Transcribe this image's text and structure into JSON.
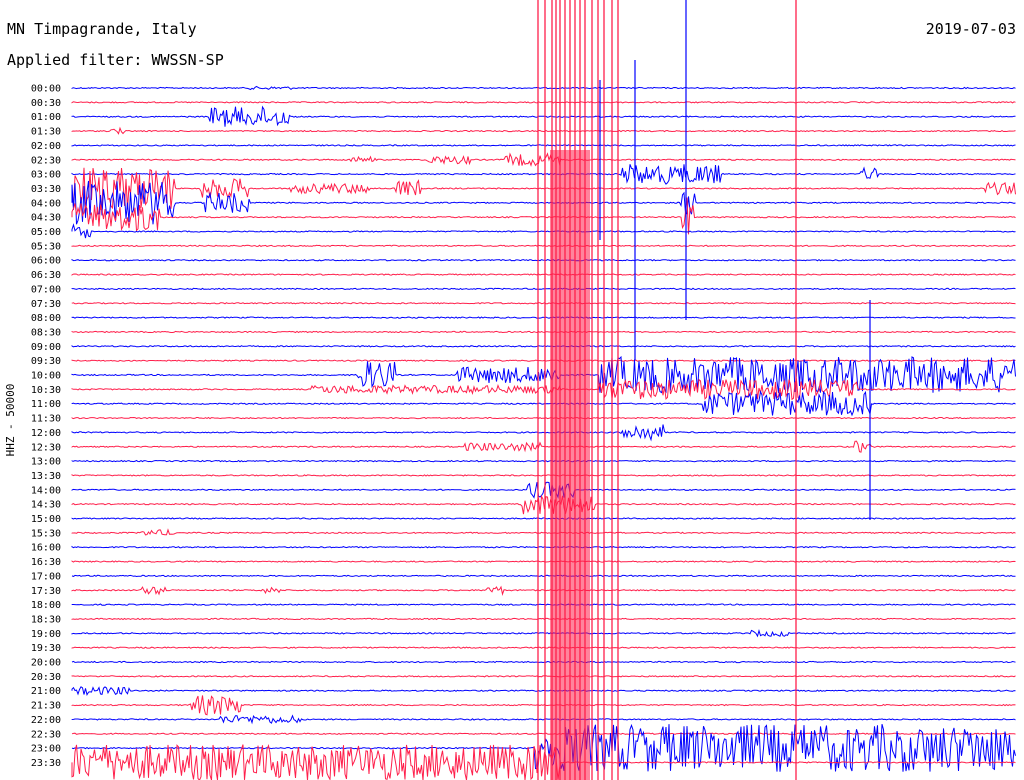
{
  "header": {
    "station": "MN Timpagrande, Italy",
    "filter": "Applied filter: WWSSN-SP",
    "date": "2019-07-03"
  },
  "side_label": "HHZ - 50000",
  "colors": {
    "blue": "#0000ff",
    "red": "#ff1f4b",
    "text": "#000000"
  },
  "chart_data": {
    "type": "line",
    "title": "MN Timpagrande, Italy",
    "ylabel": "HHZ - 50000",
    "grid": false,
    "row_labels": [
      "00:00",
      "00:30",
      "01:00",
      "01:30",
      "02:00",
      "02:30",
      "03:00",
      "03:30",
      "04:00",
      "04:30",
      "05:00",
      "05:30",
      "06:00",
      "06:30",
      "07:00",
      "07:30",
      "08:00",
      "08:30",
      "09:00",
      "09:30",
      "10:00",
      "10:30",
      "11:00",
      "11:30",
      "12:00",
      "12:30",
      "13:00",
      "13:30",
      "14:00",
      "14:30",
      "15:00",
      "15:30",
      "16:00",
      "16:30",
      "17:00",
      "17:30",
      "18:00",
      "18:30",
      "19:00",
      "19:30",
      "20:00",
      "20:30",
      "21:00",
      "21:30",
      "22:00",
      "22:30",
      "23:00",
      "23:30"
    ],
    "trace_colors_alternate": [
      "blue",
      "red"
    ],
    "x_range_minutes": [
      0,
      30
    ]
  }
}
